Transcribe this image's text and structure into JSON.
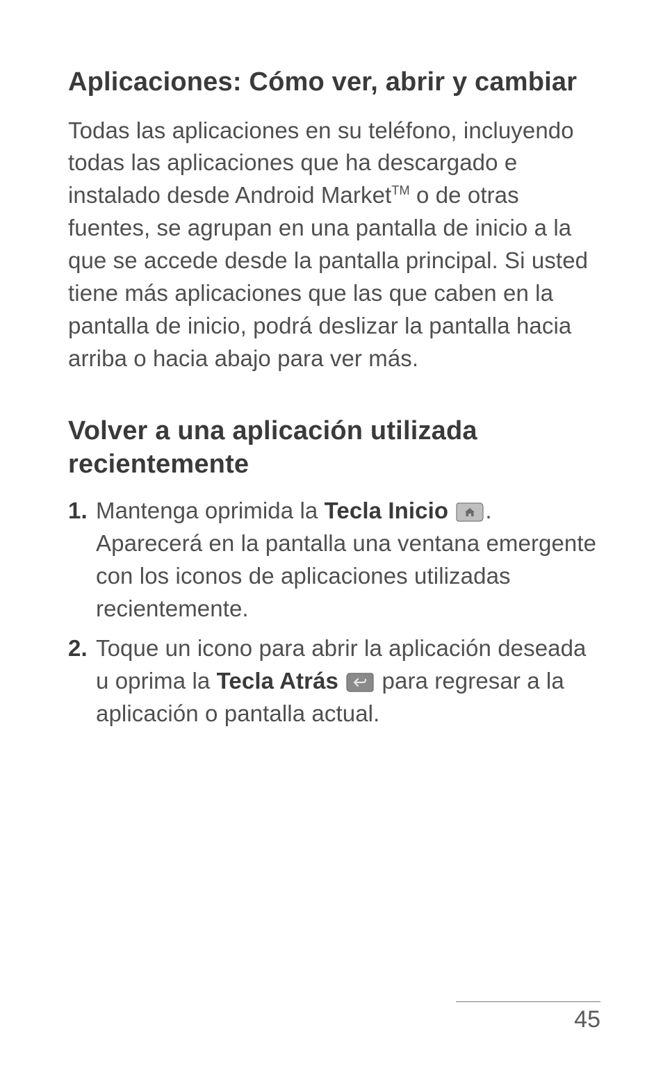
{
  "section1": {
    "title": "Aplicaciones: Cómo ver, abrir y cambiar",
    "para_a": "Todas las aplicaciones en su teléfono, incluyendo todas las aplicaciones que ha descargado e instalado desde Android Market",
    "tm": "TM",
    "para_b": " o de otras fuentes, se agrupan en una pantalla de inicio a la que se accede desde la pantalla principal. Si usted tiene más aplicaciones que las que caben en la pantalla de inicio, podrá deslizar la pantalla hacia arriba o hacia abajo para ver más."
  },
  "section2": {
    "title": "Volver a una aplicación utilizada recientemente",
    "step1": {
      "num": "1.",
      "a": " Mantenga oprimida la ",
      "key": "Tecla Inicio",
      "b": " ",
      "c": ". Aparecerá en la pantalla una ventana emergente con los iconos de aplicaciones utilizadas recientemente."
    },
    "step2": {
      "num": "2.",
      "a": "Toque un icono para abrir la aplicación deseada u oprima la ",
      "key": "Tecla Atrás",
      "b": " ",
      "c": " para regresar a la aplicación o pantalla actual."
    }
  },
  "page_number": "45"
}
